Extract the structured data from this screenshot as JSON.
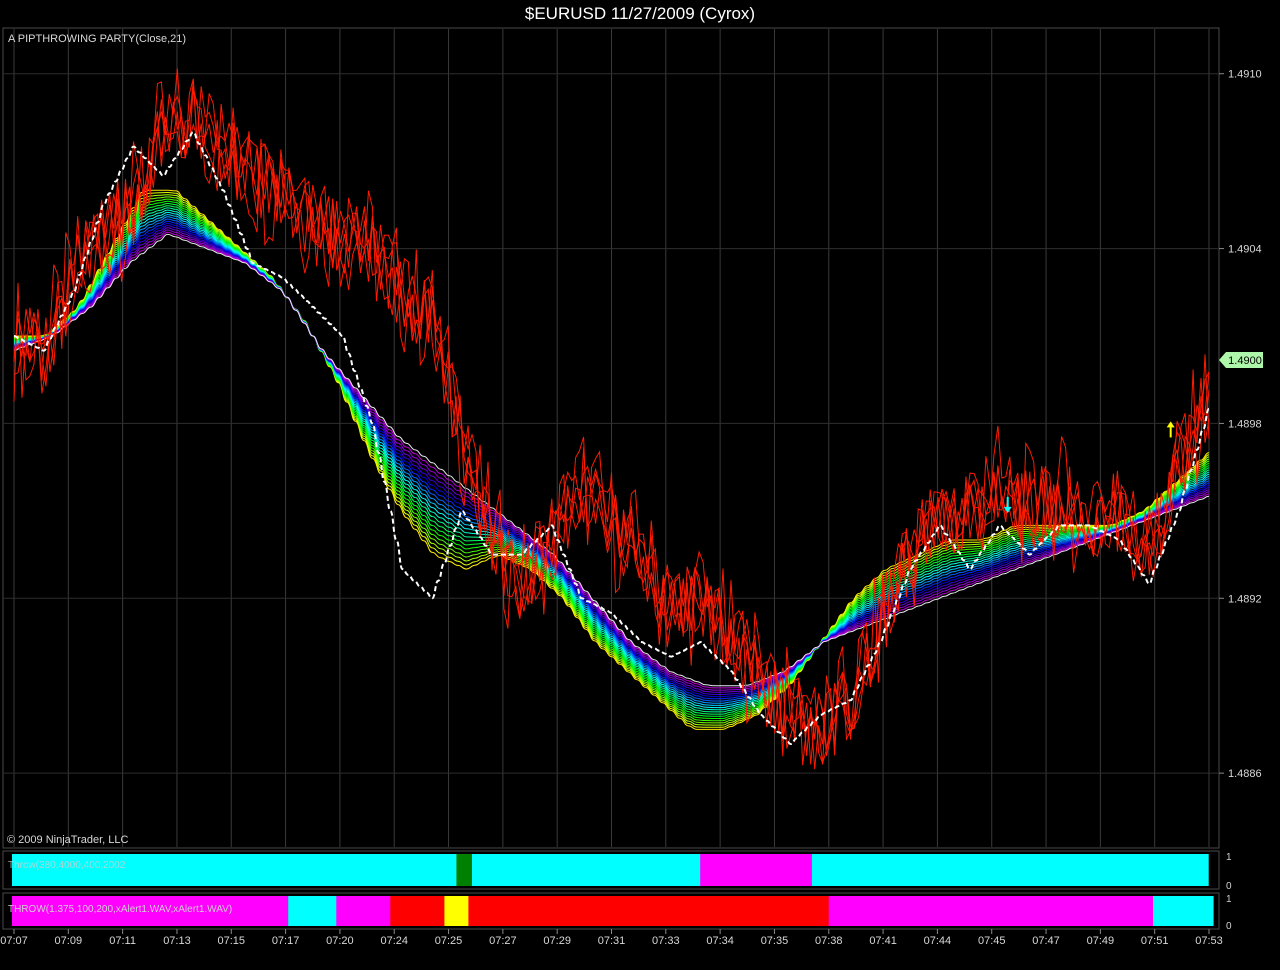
{
  "window": {
    "title": "$EURUSD  11/27/2009 (Cyrox)"
  },
  "main_panel": {
    "indicator_label": "A PIPTHROWING PARTY(Close,21)",
    "copyright": "© 2009 NinjaTrader, LLC",
    "price_tag": "1.4900"
  },
  "panel2": {
    "label": "Throw(380,4000,400,2002",
    "axis_top": "1",
    "axis_bottom": "0"
  },
  "panel3": {
    "label": "THROW(1.375,100,200,xAlert1.WAV,xAlert1.WAV)",
    "axis_top": "1",
    "axis_bottom": "0"
  },
  "colors": {
    "background": "#000000",
    "price": "#ff1a00",
    "signal": "#ffffff",
    "cyan": "#00ffff",
    "magenta": "#ff00ff",
    "red": "#ff0000",
    "yellow": "#ffff00",
    "green": "#008000",
    "tag": "#aef7aa"
  },
  "chart_data": {
    "type": "line",
    "title": "$EURUSD  11/27/2009 (Cyrox)",
    "x_tick_labels": [
      "07:07",
      "07:09",
      "07:11",
      "07:13",
      "07:15",
      "07:17",
      "07:20",
      "07:24",
      "07:25",
      "07:27",
      "07:29",
      "07:31",
      "07:33",
      "07:34",
      "07:35",
      "07:38",
      "07:41",
      "07:44",
      "07:45",
      "07:47",
      "07:49",
      "07:51",
      "07:53"
    ],
    "y_tick_labels": [
      "1.4910",
      "1.4904",
      "1.4898",
      "1.4892",
      "1.4886"
    ],
    "y_ticks": [
      1.491,
      1.4904,
      1.4898,
      1.4892,
      1.4886
    ],
    "ylim": [
      1.48835,
      1.49115
    ],
    "grid": true,
    "series": [
      {
        "role": "price",
        "y": [
          1.4901,
          1.49005,
          1.4903,
          1.49045,
          1.49055,
          1.4908,
          1.49085,
          1.49075,
          1.49065,
          1.4906,
          1.4905,
          1.49045,
          1.4904,
          1.49025,
          1.49015,
          1.48975,
          1.4894,
          1.48925,
          1.4894,
          1.4896,
          1.48945,
          1.48935,
          1.48915,
          1.4892,
          1.48905,
          1.48895,
          1.4888,
          1.48875,
          1.48885,
          1.4891,
          1.48935,
          1.48945,
          1.4895,
          1.4896,
          1.4895,
          1.48955,
          1.48945,
          1.4895,
          1.48935,
          1.48965,
          1.4899
        ]
      },
      {
        "role": "signal",
        "y": [
          1.4901,
          1.49005,
          1.49025,
          1.49055,
          1.49075,
          1.49065,
          1.4908,
          1.4906,
          1.49035,
          1.4903,
          1.4902,
          1.4901,
          1.4898,
          1.4893,
          1.4892,
          1.4895,
          1.48935,
          1.48935,
          1.48945,
          1.4892,
          1.48915,
          1.48905,
          1.489,
          1.48905,
          1.48895,
          1.4888,
          1.4887,
          1.4888,
          1.48885,
          1.48905,
          1.4893,
          1.48945,
          1.4893,
          1.48945,
          1.48935,
          1.48945,
          1.48945,
          1.4894,
          1.48925,
          1.4895,
          1.48985
        ]
      },
      {
        "role": "ribbon-inner",
        "y": [
          1.4901,
          1.4901,
          1.4902,
          1.4904,
          1.4906,
          1.4906,
          1.4905,
          1.4904,
          1.4903,
          1.49015,
          1.48995,
          1.4897,
          1.4895,
          1.48935,
          1.4893,
          1.48935,
          1.4893,
          1.4892,
          1.48905,
          1.48895,
          1.48885,
          1.48875,
          1.48875,
          1.4888,
          1.4889,
          1.48905,
          1.4892,
          1.4893,
          1.48935,
          1.4894,
          1.4894,
          1.48945,
          1.48945,
          1.48945,
          1.48945,
          1.4895,
          1.4896,
          1.4897
        ]
      },
      {
        "role": "ribbon-outer",
        "y": [
          1.49005,
          1.4901,
          1.4902,
          1.49035,
          1.49045,
          1.4904,
          1.49035,
          1.49025,
          1.49005,
          1.4899,
          1.48975,
          1.48965,
          1.48955,
          1.48945,
          1.48935,
          1.4892,
          1.48905,
          1.48895,
          1.4889,
          1.4889,
          1.48895,
          1.48905,
          1.4891,
          1.48915,
          1.4892,
          1.48925,
          1.4893,
          1.48935,
          1.4894,
          1.48945,
          1.4895,
          1.48955
        ]
      }
    ],
    "markers": [
      {
        "type": "down-arrow",
        "color": "#00ffff",
        "x": "07:45",
        "y": 1.4895
      },
      {
        "type": "up-arrow",
        "color": "#ffff00",
        "x": "07:51",
        "y": 1.4898
      }
    ],
    "panels": [
      {
        "label": "Throw(380,4000,400,2002",
        "type": "state-bar",
        "segments": [
          {
            "state": "cyan",
            "share": 0.37
          },
          {
            "state": "green",
            "share": 0.013
          },
          {
            "state": "cyan",
            "share": 0.19
          },
          {
            "state": "magenta",
            "share": 0.093
          },
          {
            "state": "cyan",
            "share": 0.33
          }
        ]
      },
      {
        "label": "THROW(1.375,100,200,xAlert1.WAV,xAlert1.WAV)",
        "type": "state-bar",
        "segments": [
          {
            "state": "magenta",
            "share": 0.23
          },
          {
            "state": "cyan",
            "share": 0.04
          },
          {
            "state": "magenta",
            "share": 0.045
          },
          {
            "state": "red",
            "share": 0.045
          },
          {
            "state": "yellow",
            "share": 0.02
          },
          {
            "state": "red",
            "share": 0.3
          },
          {
            "state": "magenta",
            "share": 0.27
          },
          {
            "state": "cyan",
            "share": 0.05
          }
        ]
      }
    ]
  }
}
